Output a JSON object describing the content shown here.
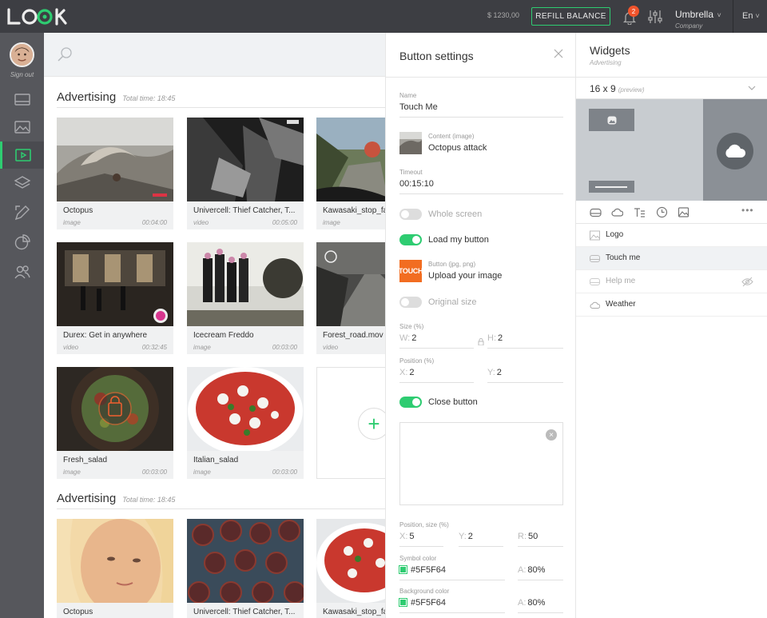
{
  "app": {
    "logo_text": "LOOK"
  },
  "topbar": {
    "balance": "$ 1230,00",
    "refill_label": "REFILL BALANCE",
    "notifications": "2",
    "company": "Umbrella",
    "company_chevron": "˅",
    "company_sub": "Company",
    "language": "En",
    "language_chevron": "˅",
    "icons": [
      "bell-icon",
      "sliders-icon"
    ]
  },
  "sidebar": {
    "signout": "Sign out",
    "items": [
      "monitor-icon",
      "image-icon",
      "video-icon",
      "layers-icon",
      "edit-icon",
      "chart-icon",
      "users-icon"
    ],
    "active": "video-icon"
  },
  "sections": [
    {
      "title": "Advertising",
      "total": "Total time: 18:45",
      "items": [
        {
          "name": "Octopus",
          "type": "image",
          "duration": "00:04:00"
        },
        {
          "name": "Univercell: Thief Catcher, T...",
          "type": "video",
          "duration": "00:05:00"
        },
        {
          "name": "Kawasaki_stop_fa",
          "type": "image",
          "duration": ""
        },
        {
          "name": "Durex: Get in anywhere",
          "type": "video",
          "duration": "00:32:45"
        },
        {
          "name": "Icecream Freddo",
          "type": "image",
          "duration": "00:03:00"
        },
        {
          "name": "Forest_road.mov",
          "type": "video",
          "duration": ""
        },
        {
          "name": "Fresh_salad",
          "type": "image",
          "duration": "00:03:00"
        },
        {
          "name": "Italian_salad",
          "type": "image",
          "duration": "00:03:00"
        }
      ]
    },
    {
      "title": "Advertising",
      "total": "Total time: 18:45",
      "items": [
        {
          "name": "Octopus"
        },
        {
          "name": "Univercell: Thief Catcher, T..."
        },
        {
          "name": "Kawasaki_stop_fa"
        }
      ]
    }
  ],
  "add_label": "+",
  "settings": {
    "title": "Button settings",
    "name_label": "Name",
    "name_value": "Touch Me",
    "content_label": "Content (image)",
    "content_value": "Octopus attack",
    "timeout_label": "Timeout",
    "timeout_value": "00:15:10",
    "whole_screen": {
      "label": "Whole screen",
      "on": false
    },
    "load_button": {
      "label": "Load my button",
      "on": true
    },
    "button_label": "Button (jpg, png)",
    "button_value": "Upload your image",
    "touch_text": "TOUCH",
    "original_size": {
      "label": "Original size",
      "on": false
    },
    "size_label": "Size (%)",
    "size_w_prefix": "W:",
    "size_w": "2",
    "size_h_prefix": "H:",
    "size_h": "2",
    "position_label": "Position (%)",
    "pos_x_prefix": "X:",
    "pos_x": "2",
    "pos_y_prefix": "Y:",
    "pos_y": "2",
    "close_button": {
      "label": "Close button",
      "on": true
    },
    "close_box_x": "×",
    "possize_label": "Position, size (%)",
    "ps_x_prefix": "X:",
    "ps_x": "5",
    "ps_y_prefix": "Y:",
    "ps_y": "2",
    "ps_r_prefix": "R:",
    "ps_r": "50",
    "symbol_color_label": "Symbol color",
    "symbol_color": "#5F5F64",
    "symbol_alpha_prefix": "A:",
    "symbol_alpha": "80%",
    "background_color_label": "Background color",
    "background_color": "#5F5F64",
    "background_alpha_prefix": "A:",
    "background_alpha": "80%"
  },
  "widgets": {
    "title": "Widgets",
    "subtitle": "Advertising",
    "ratio": "16 x 9",
    "ratio_note": "(preview)",
    "tools": [
      "button-icon",
      "cloud-icon",
      "text-icon",
      "clock-icon",
      "image-icon"
    ],
    "more": "•••",
    "items": [
      {
        "label": "Logo",
        "icon": "image-icon"
      },
      {
        "label": "Touch me",
        "icon": "button-icon",
        "selected": true
      },
      {
        "label": "Help me",
        "icon": "button-icon",
        "hidden": true
      },
      {
        "label": "Weather",
        "icon": "cloud-icon"
      }
    ]
  },
  "colors": {
    "accent": "#2ecc71",
    "badge": "#f0542c",
    "dark": "#3d3e43"
  }
}
